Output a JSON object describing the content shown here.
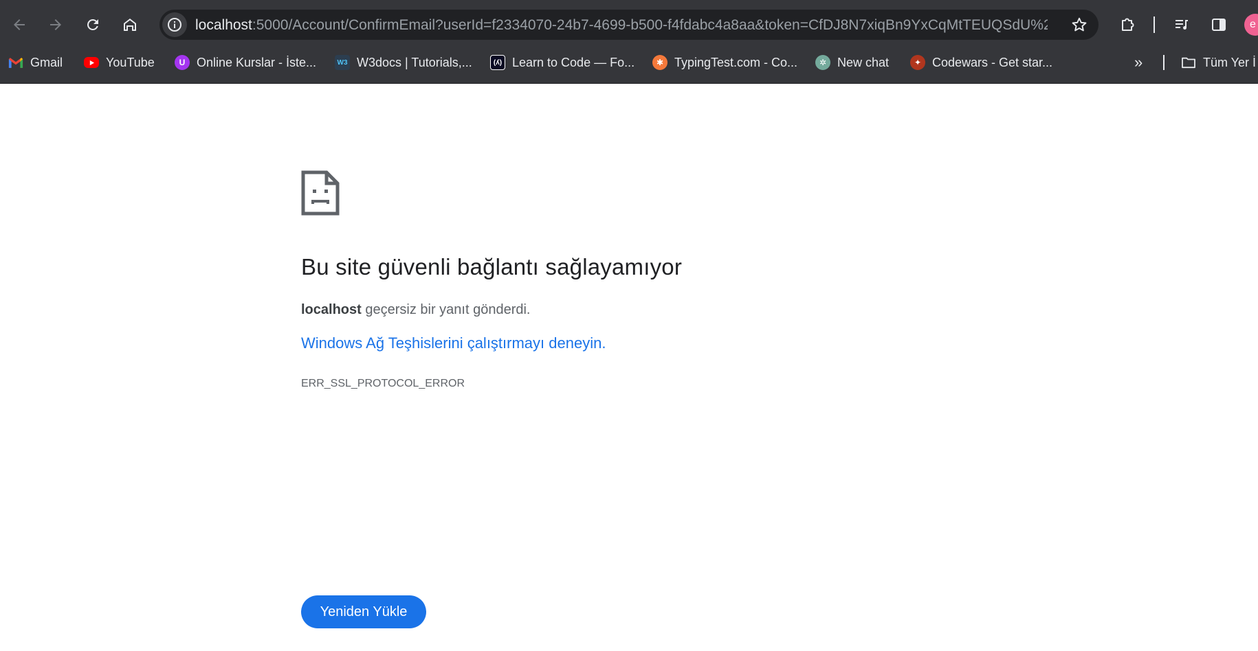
{
  "browser": {
    "address_bar": {
      "host": "localhost",
      "rest": ":5000/Account/ConfirmEmail?userId=f2334070-24b7-4699-b500-f4fdabc4a8aa&token=CfDJ8N7xiqBn9YxCqMtTEUQSdU%2F..."
    },
    "bookmarks": [
      {
        "label": "Gmail",
        "icon": "gmail-icon"
      },
      {
        "label": "YouTube",
        "icon": "youtube-icon"
      },
      {
        "label": "Online Kurslar - İste...",
        "icon": "udemy-icon"
      },
      {
        "label": "W3docs | Tutorials,...",
        "icon": "w3docs-icon"
      },
      {
        "label": "Learn to Code — Fo...",
        "icon": "freecodecamp-icon"
      },
      {
        "label": "TypingTest.com - Co...",
        "icon": "typingtest-icon"
      },
      {
        "label": "New chat",
        "icon": "chatgpt-icon"
      },
      {
        "label": "Codewars - Get star...",
        "icon": "codewars-icon"
      }
    ],
    "more_bookmarks_glyph": "»",
    "all_bookmarks_label": "Tüm Yer İ",
    "profile_initial": "e",
    "colors": {
      "chrome_bg": "#35363a",
      "omnibox_bg": "#202124",
      "link_blue": "#1a73e8",
      "profile_pink": "#f06292"
    }
  },
  "error_page": {
    "icon": "sad-document-icon",
    "title": "Bu site güvenli bağlantı sağlayamıyor",
    "description_host": "localhost",
    "description_text": " geçersiz bir yanıt gönderdi.",
    "diagnostics_link": "Windows Ağ Teşhislerini çalıştırmayı deneyin.",
    "error_code": "ERR_SSL_PROTOCOL_ERROR",
    "reload_button": "Yeniden Yükle"
  }
}
